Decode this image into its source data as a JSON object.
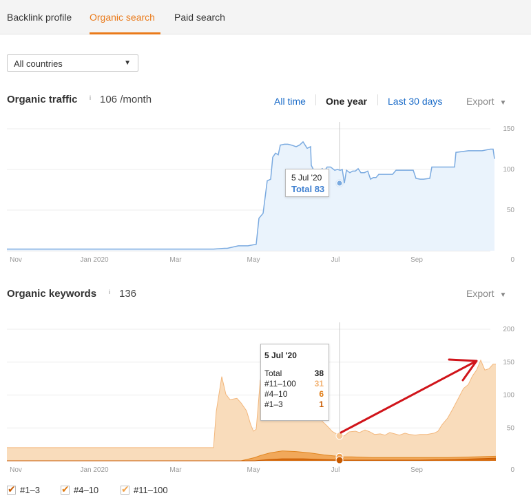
{
  "tabs": [
    {
      "label": "Backlink profile",
      "active": false
    },
    {
      "label": "Organic search",
      "active": true
    },
    {
      "label": "Paid search",
      "active": false
    }
  ],
  "country_select": {
    "value": "All countries"
  },
  "traffic": {
    "title": "Organic traffic",
    "info": "i",
    "value": "106 /month",
    "ranges": [
      {
        "label": "All time",
        "active": false
      },
      {
        "label": "One year",
        "active": true
      },
      {
        "label": "Last 30 days",
        "active": false
      }
    ],
    "export_label": "Export",
    "tooltip": {
      "date": "5 Jul '20",
      "total": "Total 83"
    }
  },
  "keywords": {
    "title": "Organic keywords",
    "info": "i",
    "value": "136",
    "export_label": "Export",
    "tooltip": {
      "date": "5 Jul '20",
      "rows": [
        {
          "label": "Total",
          "value": "38"
        },
        {
          "label": "#11–100",
          "value": "31"
        },
        {
          "label": "#4–10",
          "value": "6"
        },
        {
          "label": "#1–3",
          "value": "1"
        }
      ]
    }
  },
  "legend": [
    {
      "label": "#1–3",
      "checked": true,
      "color": "#c85a00"
    },
    {
      "label": "#4–10",
      "checked": true,
      "color": "#e07b12"
    },
    {
      "label": "#11–100",
      "checked": true,
      "color": "#f2a34a"
    }
  ],
  "colors": {
    "accent": "#ea7a1a",
    "link": "#1a6bc8",
    "traffic_line": "#7aaae0",
    "traffic_fill": "#eaf3fc",
    "kw_fill": "#f9dcbb",
    "arrow": "#d0141a"
  },
  "chart_data": [
    {
      "type": "area",
      "x_labels": [
        "Nov",
        "Jan 2020",
        "Mar",
        "May",
        "Jul",
        "Sep"
      ],
      "y_ticks": [
        0,
        50,
        100,
        150
      ],
      "ylim": [
        0,
        150
      ],
      "grid": true,
      "series": [
        {
          "values": [
            [
              0,
              2
            ],
            [
              20,
              2
            ],
            [
              40,
              2
            ],
            [
              60,
              2
            ],
            [
              80,
              2
            ],
            [
              100,
              2
            ],
            [
              120,
              2
            ],
            [
              140,
              2
            ],
            [
              160,
              2
            ],
            [
              180,
              2
            ],
            [
              200,
              2
            ],
            [
              220,
              2
            ],
            [
              240,
              2
            ],
            [
              260,
              2
            ],
            [
              280,
              2
            ],
            [
              300,
              2
            ],
            [
              316,
              3
            ],
            [
              320,
              3
            ],
            [
              336,
              6
            ],
            [
              350,
              6
            ],
            [
              362,
              8
            ],
            [
              366,
              40
            ],
            [
              372,
              46
            ],
            [
              378,
              86
            ],
            [
              383,
              88
            ],
            [
              386,
              115
            ],
            [
              390,
              120
            ],
            [
              394,
              118
            ],
            [
              397,
              130
            ],
            [
              403,
              131
            ],
            [
              408,
              131
            ],
            [
              413,
              130
            ],
            [
              420,
              128
            ],
            [
              425,
              130
            ],
            [
              430,
              134
            ],
            [
              436,
              126
            ],
            [
              441,
              128
            ],
            [
              442,
              105
            ],
            [
              445,
              100
            ],
            [
              452,
              98
            ],
            [
              458,
              101
            ],
            [
              461,
              98
            ],
            [
              465,
              103
            ],
            [
              470,
              103
            ],
            [
              476,
              99
            ],
            [
              480,
              100
            ],
            [
              484,
              99
            ],
            [
              487,
              100
            ],
            [
              490,
              83
            ],
            [
              493,
              99
            ],
            [
              498,
              96
            ],
            [
              502,
              98
            ],
            [
              506,
              98
            ],
            [
              510,
              101
            ],
            [
              514,
              96
            ],
            [
              519,
              96
            ],
            [
              524,
              98
            ],
            [
              528,
              88
            ],
            [
              532,
              90
            ],
            [
              536,
              90
            ],
            [
              540,
              94
            ],
            [
              560,
              94
            ],
            [
              565,
              99
            ],
            [
              590,
              99
            ],
            [
              594,
              89
            ],
            [
              600,
              88
            ],
            [
              605,
              88
            ],
            [
              614,
              89
            ],
            [
              617,
              103
            ],
            [
              650,
              103
            ],
            [
              652,
              121
            ],
            [
              670,
              123
            ],
            [
              690,
              123
            ],
            [
              702,
              125
            ],
            [
              706,
              125
            ],
            [
              708,
              113
            ]
          ]
        }
      ]
    },
    {
      "type": "area",
      "x_labels": [
        "Nov",
        "Jan 2020",
        "Mar",
        "May",
        "Jul",
        "Sep"
      ],
      "y_ticks": [
        0,
        50,
        100,
        150,
        200
      ],
      "ylim": [
        0,
        200
      ],
      "grid": true,
      "series": [
        {
          "name": "#11–100",
          "values": [
            [
              0,
              20
            ],
            [
              100,
              20
            ],
            [
              200,
              20
            ],
            [
              300,
              20
            ],
            [
              304,
              75
            ],
            [
              312,
              128
            ],
            [
              318,
              101
            ],
            [
              324,
              93
            ],
            [
              334,
              95
            ],
            [
              340,
              88
            ],
            [
              348,
              76
            ],
            [
              354,
              55
            ],
            [
              358,
              45
            ],
            [
              362,
              48
            ],
            [
              368,
              123
            ],
            [
              373,
              106
            ],
            [
              379,
              115
            ],
            [
              385,
              140
            ],
            [
              389,
              125
            ],
            [
              396,
              129
            ],
            [
              400,
              119
            ],
            [
              408,
              105
            ],
            [
              416,
              97
            ],
            [
              425,
              110
            ],
            [
              428,
              77
            ],
            [
              433,
              75
            ],
            [
              438,
              86
            ],
            [
              445,
              98
            ],
            [
              450,
              76
            ],
            [
              458,
              60
            ],
            [
              465,
              53
            ],
            [
              472,
              45
            ],
            [
              480,
              40
            ],
            [
              486,
              38
            ],
            [
              490,
              38
            ],
            [
              497,
              44
            ],
            [
              506,
              45
            ],
            [
              512,
              43
            ],
            [
              520,
              47
            ],
            [
              527,
              44
            ],
            [
              534,
              40
            ],
            [
              542,
              41
            ],
            [
              549,
              39
            ],
            [
              556,
              43
            ],
            [
              563,
              41
            ],
            [
              570,
              39
            ],
            [
              578,
              42
            ],
            [
              585,
              40
            ],
            [
              593,
              39
            ],
            [
              600,
              40
            ],
            [
              610,
              40
            ],
            [
              620,
              42
            ],
            [
              626,
              45
            ],
            [
              632,
              55
            ],
            [
              640,
              65
            ],
            [
              648,
              80
            ],
            [
              655,
              94
            ],
            [
              663,
              110
            ],
            [
              670,
              116
            ],
            [
              676,
              129
            ],
            [
              682,
              138
            ],
            [
              688,
              153
            ],
            [
              694,
              138
            ],
            [
              700,
              140
            ],
            [
              706,
              147
            ],
            [
              710,
              147
            ]
          ]
        },
        {
          "name": "#4–10",
          "values": [
            [
              0,
              0
            ],
            [
              340,
              0
            ],
            [
              360,
              5
            ],
            [
              368,
              8
            ],
            [
              382,
              12
            ],
            [
              400,
              15
            ],
            [
              420,
              14
            ],
            [
              440,
              12
            ],
            [
              460,
              9
            ],
            [
              480,
              7
            ],
            [
              490,
              6
            ],
            [
              500,
              6
            ],
            [
              530,
              5
            ],
            [
              560,
              5
            ],
            [
              600,
              5
            ],
            [
              640,
              5
            ],
            [
              680,
              6
            ],
            [
              710,
              7
            ]
          ]
        },
        {
          "name": "#1–3",
          "values": [
            [
              0,
              0
            ],
            [
              360,
              0
            ],
            [
              380,
              2
            ],
            [
              400,
              3
            ],
            [
              430,
              3
            ],
            [
              460,
              2
            ],
            [
              490,
              1
            ],
            [
              520,
              1
            ],
            [
              560,
              1
            ],
            [
              600,
              1
            ],
            [
              650,
              2
            ],
            [
              680,
              3
            ],
            [
              710,
              4
            ]
          ]
        }
      ]
    }
  ]
}
